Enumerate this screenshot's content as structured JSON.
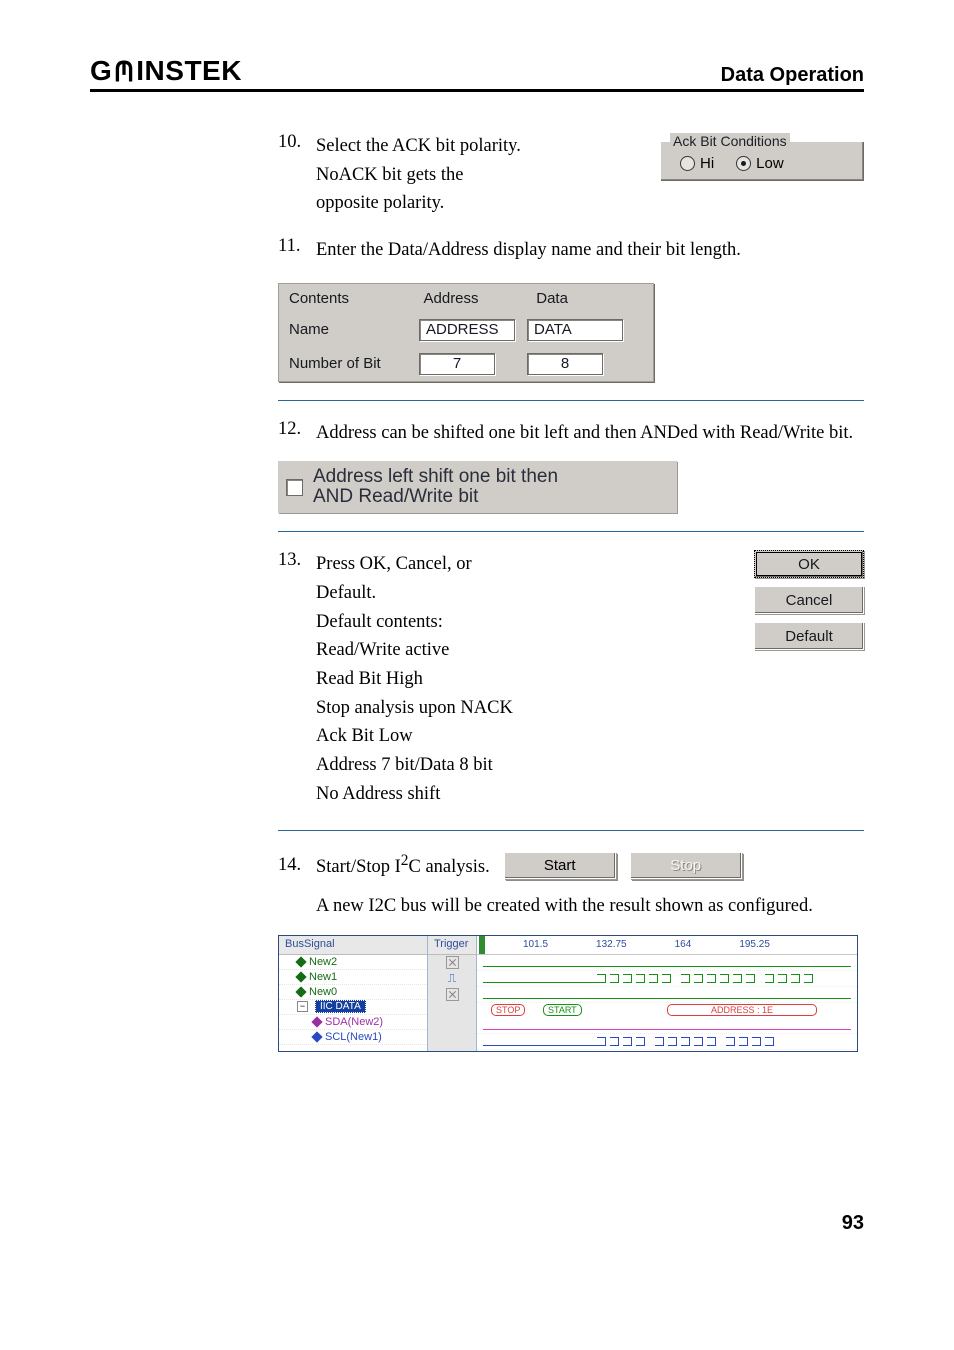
{
  "header": {
    "logo_left": "G",
    "logo_right": "INSTEK",
    "section": "Data Operation"
  },
  "step10": {
    "num": "10.",
    "text_line1": "Select the ACK bit polarity.",
    "text_line2": "NoACK bit gets the",
    "text_line3": "opposite polarity.",
    "group_legend": "Ack Bit Conditions",
    "radio_hi": "Hi",
    "radio_low": "Low"
  },
  "step11": {
    "num": "11.",
    "text": "Enter the Data/Address display name and their bit length.",
    "table": {
      "head_contents": "Contents",
      "head_address": "Address",
      "head_data": "Data",
      "row_name_label": "Name",
      "row_name_addr": "ADDRESS",
      "row_name_data": "DATA",
      "row_bits_label": "Number of Bit",
      "row_bits_addr": "7",
      "row_bits_data": "8"
    }
  },
  "step12": {
    "num": "12.",
    "text": "Address can be shifted one bit left and then ANDed with Read/Write bit.",
    "checkbox_line1": "Address left shift one bit then",
    "checkbox_line2": "AND Read/Write bit"
  },
  "step13": {
    "num": "13.",
    "lines": [
      "Press OK, Cancel, or",
      "Default.",
      "Default contents:",
      "Read/Write active",
      "Read Bit High",
      "Stop analysis upon NACK",
      "Ack Bit Low",
      "Address 7 bit/Data 8 bit",
      "No Address shift"
    ],
    "btn_ok": "OK",
    "btn_cancel": "Cancel",
    "btn_default": "Default"
  },
  "step14": {
    "num": "14.",
    "line1_a": "Start/Stop I",
    "line1_sup": "2",
    "line1_b": "C analysis.",
    "btn_start": "Start",
    "btn_stop": "Stop",
    "result_text": "A new I2C bus will be created with the result shown as configured."
  },
  "waveform": {
    "head_left": "BusSignal",
    "head_trig": "Trigger",
    "ticks": [
      "101.5",
      "132.75",
      "164",
      "195.25"
    ],
    "rows": {
      "new2": "New2",
      "new1": "New1",
      "new0": "New0",
      "iic": "IIC DATA",
      "sda": "SDA(New2)",
      "scl": "SCL(New1)"
    },
    "caps": {
      "stop": "STOP",
      "start": "START",
      "addr": "ADDRESS : 1E"
    }
  },
  "page_number": "93"
}
